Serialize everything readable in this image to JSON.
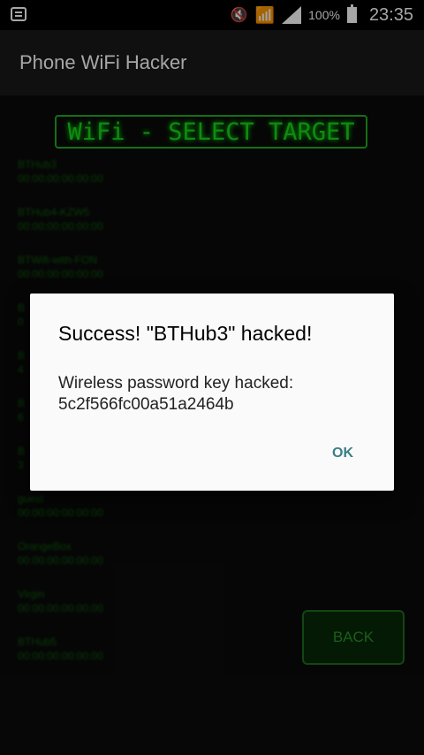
{
  "statusbar": {
    "battery": "100%",
    "time": "23:35",
    "icons": [
      "notification-icon",
      "mute-icon",
      "wifi-icon",
      "signal-icon",
      "battery-icon"
    ]
  },
  "appbar": {
    "title": "Phone WiFi Hacker"
  },
  "content": {
    "header": "WiFi - SELECT TARGET",
    "networks": [
      {
        "name": "BTHub3",
        "mac": "00:00:00:00:00:00"
      },
      {
        "name": "BTHub4-KZW5",
        "mac": "00:00:00:00:00:00"
      },
      {
        "name": "BTWifi-with-FON",
        "mac": "00:00:00:00:00:00"
      },
      {
        "name": "B",
        "mac": "0"
      },
      {
        "name": "B",
        "mac": "4"
      },
      {
        "name": "B",
        "mac": "6"
      },
      {
        "name": "B",
        "mac": "3"
      },
      {
        "name": "guest",
        "mac": "00:00:00:00:00:00"
      },
      {
        "name": "OrangeBox",
        "mac": "00:00:00:00:00:00"
      },
      {
        "name": "Virgin",
        "mac": "00:00:00:00:00:00"
      },
      {
        "name": "BTHub5",
        "mac": "00:00:00:00:00:00"
      }
    ],
    "back_label": "BACK"
  },
  "dialog": {
    "title": "Success! \"BTHub3\" hacked!",
    "message": "Wireless password key hacked: 5c2f566fc00a51a2464b",
    "ok_label": "OK"
  },
  "colors": {
    "accent": "#3a7f86",
    "matrix_green": "#19d41b"
  }
}
